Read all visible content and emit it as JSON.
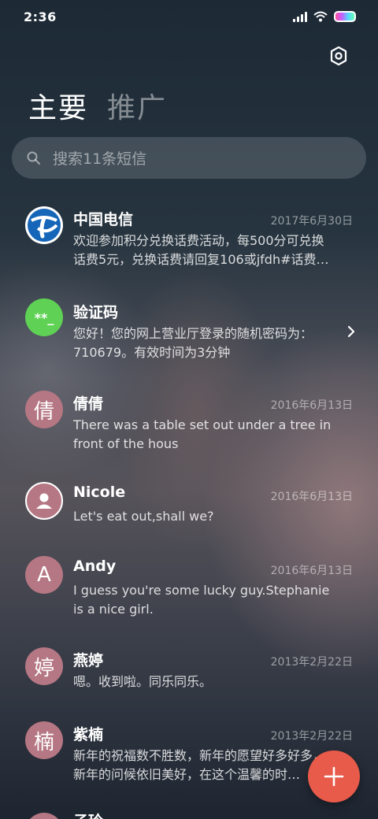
{
  "status_bar": {
    "time": "2:36"
  },
  "header": {
    "tabs": [
      {
        "label": "主要"
      },
      {
        "label": "推广"
      }
    ]
  },
  "search": {
    "placeholder": "搜索11条短信"
  },
  "conversations": [
    {
      "name": "中国电信",
      "date": "2017年6月30日",
      "line1": "欢迎参加积分兑换话费活动，每500分可兑换",
      "line2": "话费5元，兑换话费请回复106或jfdh#话费…"
    },
    {
      "name": "验证码",
      "avatar_text": "**_",
      "line1": "您好！您的网上营业厅登录的随机密码为：",
      "line2": "710679。有效时间为3分钟"
    },
    {
      "name": "倩倩",
      "avatar_text": "倩",
      "date": "2016年6月13日",
      "line1": "There was a table set out under a tree in",
      "line2": "front of the hous"
    },
    {
      "name": "Nicole",
      "date": "2016年6月13日",
      "line1": "Let's eat out,shall we?"
    },
    {
      "name": "Andy",
      "avatar_text": "A",
      "date": "2016年6月13日",
      "line1": "I guess you're some lucky guy.Stephanie",
      "line2": "is a nice girl."
    },
    {
      "name": "燕婷",
      "avatar_text": "婷",
      "date": "2013年2月22日",
      "line1": "嗯。收到啦。同乐同乐。"
    },
    {
      "name": "紫楠",
      "avatar_text": "楠",
      "date": "2013年2月22日",
      "line1": "新年的祝福数不胜数，新年的愿望好多好多，",
      "line2": "新年的问候依旧美好，在这个温馨的时…"
    },
    {
      "name": "子玲"
    }
  ],
  "colors": {
    "accent": "#e85a4a",
    "avatar": "#b57783",
    "verify": "#5fd255",
    "telecom": "#1565b8"
  }
}
